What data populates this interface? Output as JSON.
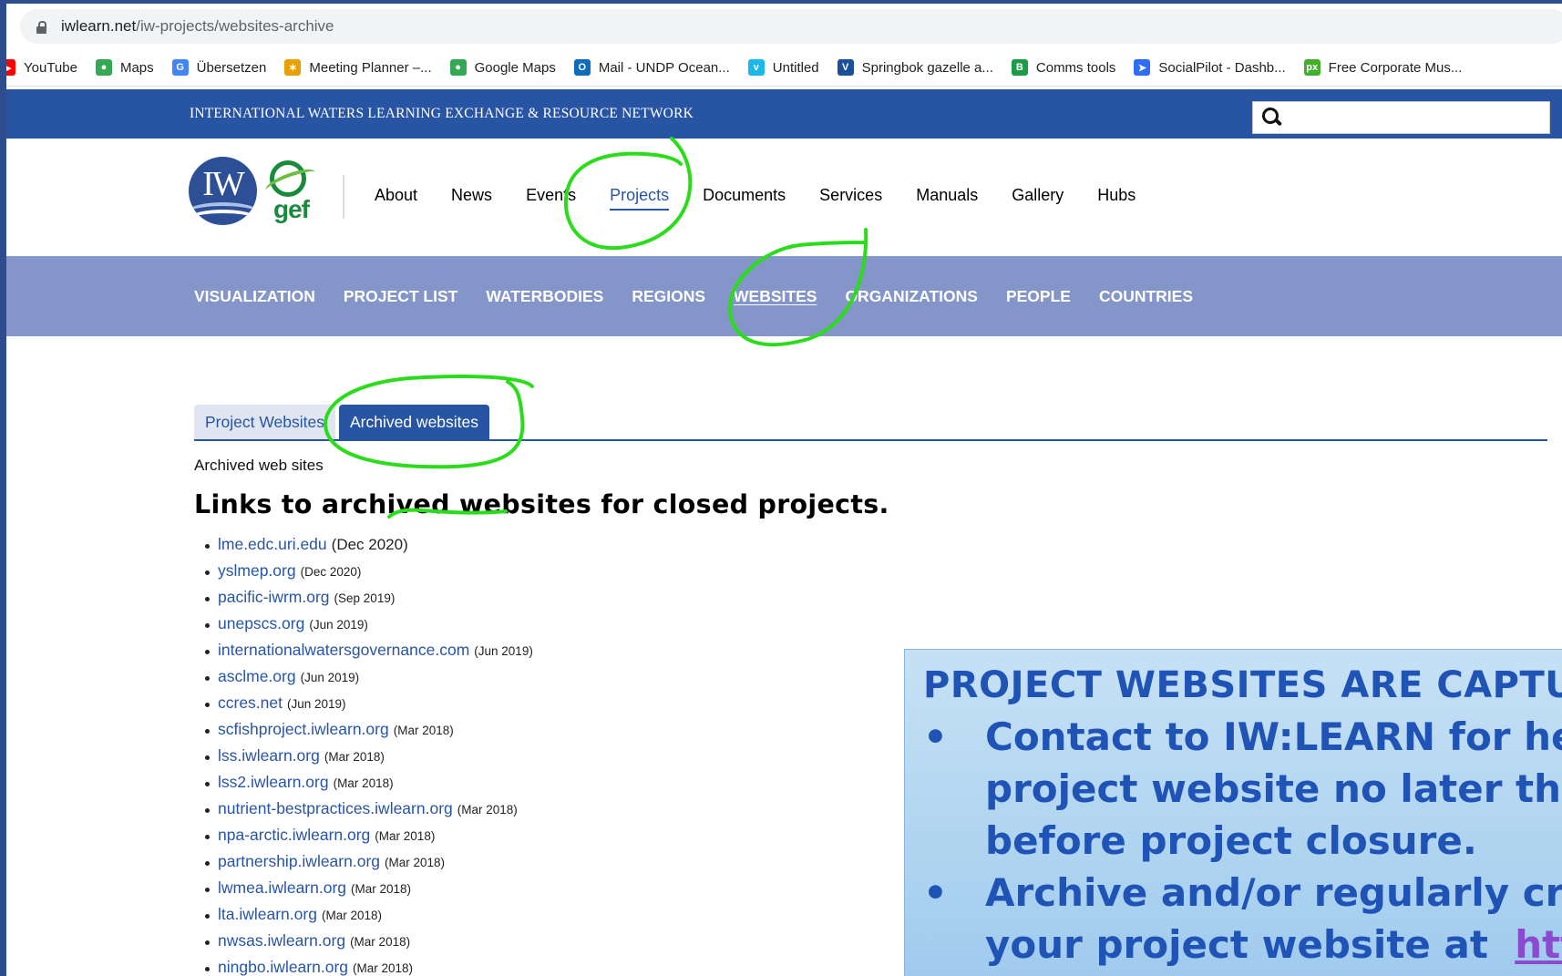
{
  "browser": {
    "url_host": "iwlearn.net",
    "url_path": "/iw-projects/websites-archive",
    "bookmarks": [
      {
        "label": "YouTube",
        "icon": "youtube-icon",
        "color": "#ff0000",
        "glyph": "▶"
      },
      {
        "label": "Maps",
        "icon": "maps-pin-icon",
        "color": "#34a853",
        "glyph": "●"
      },
      {
        "label": "Übersetzen",
        "icon": "translate-icon",
        "color": "#4285f4",
        "glyph": "G"
      },
      {
        "label": "Meeting Planner –...",
        "icon": "meeting-planner-icon",
        "color": "#e8a000",
        "glyph": "✶"
      },
      {
        "label": "Google Maps",
        "icon": "maps-pin-icon",
        "color": "#34a853",
        "glyph": "●"
      },
      {
        "label": "Mail - UNDP Ocean...",
        "icon": "outlook-icon",
        "color": "#0f6cbd",
        "glyph": "O"
      },
      {
        "label": "Untitled",
        "icon": "vimeo-icon",
        "color": "#1ab7ea",
        "glyph": "v"
      },
      {
        "label": "Springbok gazelle a...",
        "icon": "v-logo-icon",
        "color": "#1b4f9c",
        "glyph": "V"
      },
      {
        "label": "Comms tools",
        "icon": "b-logo-icon",
        "color": "#1c9b48",
        "glyph": "B"
      },
      {
        "label": "SocialPilot - Dashb...",
        "icon": "socialpilot-icon",
        "color": "#2f6df6",
        "glyph": "➤"
      },
      {
        "label": "Free Corporate Mus...",
        "icon": "px-logo-icon",
        "color": "#43b02a",
        "glyph": "px"
      }
    ]
  },
  "site": {
    "tagline": "INTERNATIONAL WATERS LEARNING EXCHANGE & RESOURCE NETWORK",
    "logo_iw": "IW",
    "logo_gef": "gef",
    "main_nav": [
      "About",
      "News",
      "Events",
      "Projects",
      "Documents",
      "Services",
      "Manuals",
      "Gallery",
      "Hubs"
    ],
    "main_nav_active": "Projects",
    "sub_nav": [
      "VISUALIZATION",
      "PROJECT LIST",
      "WATERBODIES",
      "REGIONS",
      "WEBSITES",
      "ORGANIZATIONS",
      "PEOPLE",
      "COUNTRIES"
    ],
    "sub_nav_active": "WEBSITES"
  },
  "content": {
    "tabs": [
      {
        "label": "Project Websites",
        "active": false
      },
      {
        "label": "Archived websites",
        "active": true
      }
    ],
    "label": "Archived web sites",
    "heading": "Links to archived websites for closed projects.",
    "sites": [
      {
        "name": "lme.edc.uri.edu",
        "date": "(Dec 2020)"
      },
      {
        "name": "yslmep.org",
        "date": "(Dec 2020)"
      },
      {
        "name": "pacific-iwrm.org",
        "date": "(Sep 2019)"
      },
      {
        "name": "unepscs.org",
        "date": "(Jun 2019)"
      },
      {
        "name": "internationalwatersgovernance.com",
        "date": "(Jun 2019)"
      },
      {
        "name": "asclme.org",
        "date": "(Jun 2019)"
      },
      {
        "name": "ccres.net",
        "date": "(Jun 2019)"
      },
      {
        "name": "scfishproject.iwlearn.org",
        "date": "(Mar 2018)"
      },
      {
        "name": "lss.iwlearn.org",
        "date": "(Mar 2018)"
      },
      {
        "name": "lss2.iwlearn.org",
        "date": "(Mar 2018)"
      },
      {
        "name": "nutrient-bestpractices.iwlearn.org",
        "date": "(Mar 2018)"
      },
      {
        "name": "npa-arctic.iwlearn.org",
        "date": "(Mar 2018)"
      },
      {
        "name": "partnership.iwlearn.org",
        "date": "(Mar 2018)"
      },
      {
        "name": "lwmea.iwlearn.org",
        "date": "(Mar 2018)"
      },
      {
        "name": "lta.iwlearn.org",
        "date": "(Mar 2018)"
      },
      {
        "name": "nwsas.iwlearn.org",
        "date": "(Mar 2018)"
      },
      {
        "name": "ningbo.iwlearn.org",
        "date": "(Mar 2018)"
      }
    ]
  },
  "callout": {
    "title": "PROJECT WEBSITES ARE CAPTUR",
    "bullet_glyph": "•",
    "lines": [
      "Contact to IW:LEARN for help",
      "project website no later than",
      "before project closure.",
      "Archive  and/or regularly cr",
      "your project website at"
    ],
    "link_fragment": "http"
  },
  "colors": {
    "brand_blue": "#2855a3",
    "subnav_blue": "#8496c9",
    "annotation_green": "#2bdc1b",
    "callout_text": "#1f53b6"
  }
}
